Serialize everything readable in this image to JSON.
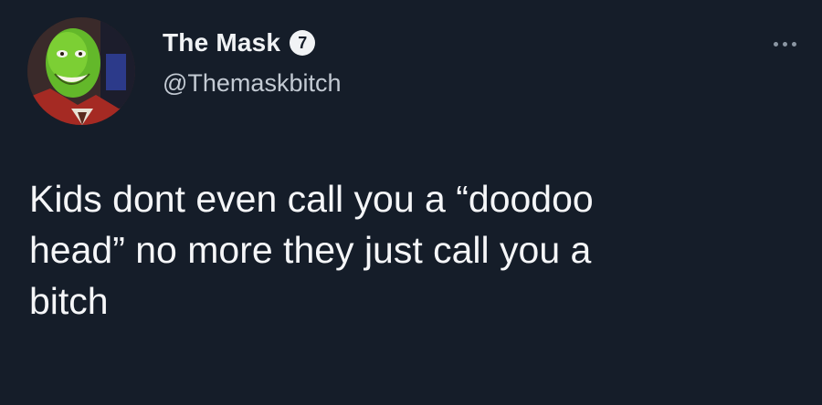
{
  "tweet": {
    "author": {
      "display_name": "The Mask",
      "handle": "@Themaskbitch",
      "badge_value": "7"
    },
    "text_lines": [
      "Kids dont even call you a “doodoo",
      "head” no more they just call you a",
      "bitch"
    ]
  },
  "icons": {
    "more": "more-options-icon",
    "badge": "number-badge-icon"
  },
  "colors": {
    "background": "#151d29",
    "text": "#f5f6f8",
    "handle": "#c3cad3"
  }
}
